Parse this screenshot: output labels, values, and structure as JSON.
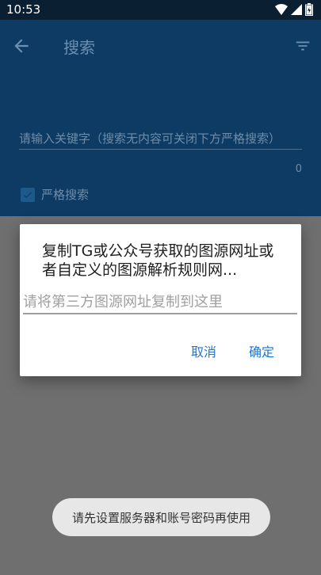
{
  "status_bar": {
    "time": "10:53"
  },
  "app_bar": {
    "title": "搜索",
    "back_icon": "arrow-left-icon",
    "filter_icon": "filter-list-icon"
  },
  "search": {
    "placeholder": "请输入关键字（搜索无内容可关闭下方严格搜索）",
    "count": "0",
    "strict_label": "严格搜索",
    "strict_checked": true
  },
  "dialog": {
    "title": "复制TG或公众号获取的图源网址或者自定义的图源解析规则网...",
    "input_placeholder": "请将第三方图源网址复制到这里",
    "cancel_label": "取消",
    "ok_label": "确定"
  },
  "toast": {
    "message": "请先设置服务器和账号密码再使用"
  },
  "colors": {
    "scrim": "#6f6f6f",
    "app_bar_dimmed": "#0d3b64",
    "accent": "#1976d2",
    "dialog_bg": "#ffffff"
  }
}
